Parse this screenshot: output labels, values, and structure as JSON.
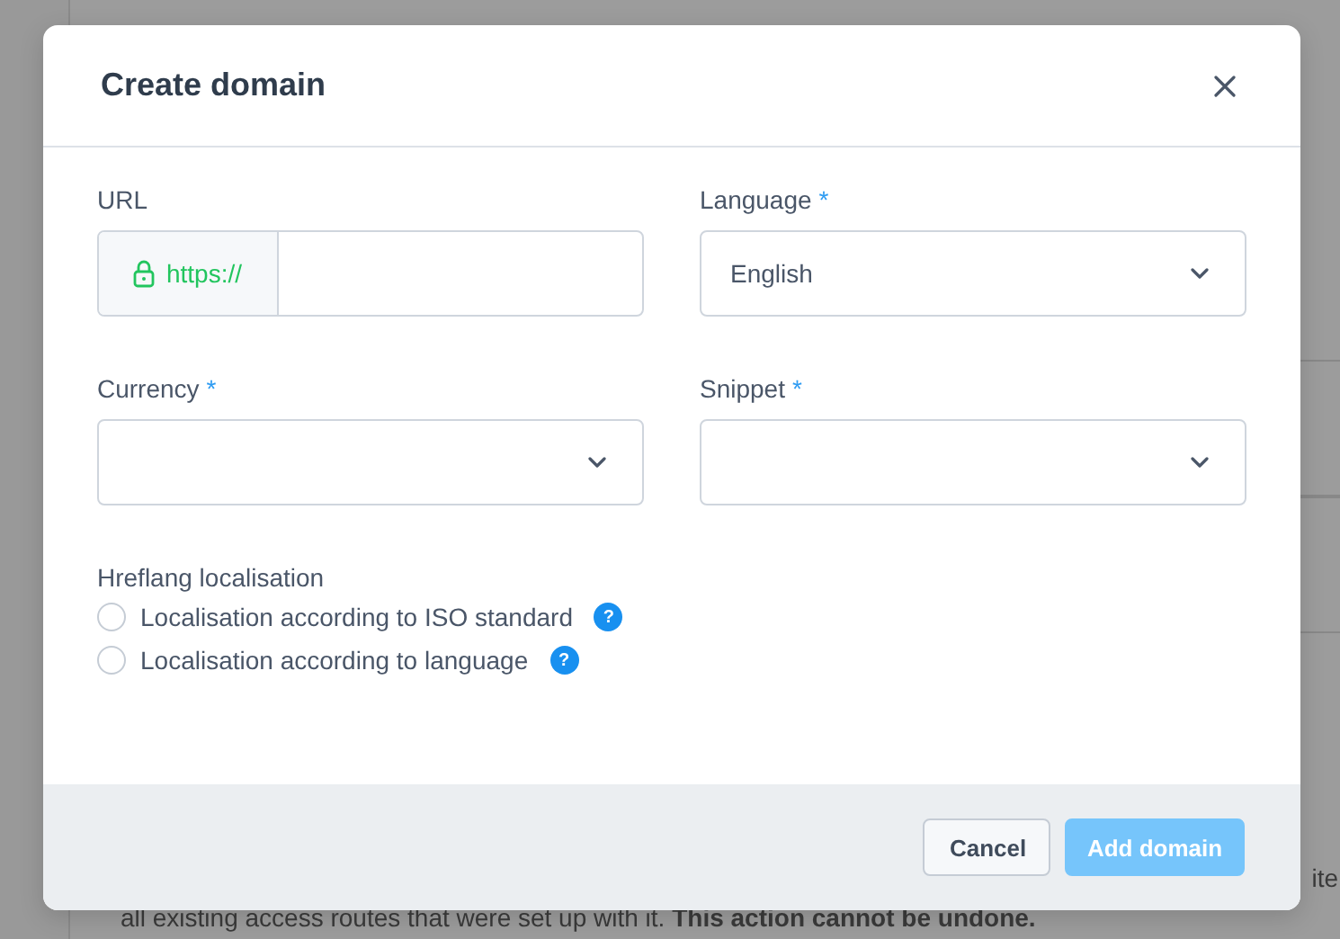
{
  "background": {
    "fragment": "ite",
    "notice": "all existing access routes that were set up with it. **This action cannot be undone.**"
  },
  "dialog": {
    "title": "Create domain",
    "fields": [
      {
        "kind": "url",
        "label": "URL",
        "prefix": "https://"
      },
      {
        "kind": "select",
        "label": "Language",
        "required_mark": "*",
        "value": "English"
      },
      {
        "kind": "select",
        "label": "Currency",
        "required_mark": "*"
      },
      {
        "kind": "select",
        "label": "Snippet",
        "required_mark": "*"
      }
    ],
    "hreflang": {
      "label": "Hreflang localisation",
      "options": [
        {
          "label": "Localisation according to ISO standard",
          "selected": false,
          "help": "?"
        },
        {
          "label": "Localisation according to language",
          "selected": false,
          "help": "?"
        }
      ]
    },
    "buttons": [
      {
        "label": "Cancel",
        "kind": "secondary",
        "disabled": false
      },
      {
        "label": "Add domain",
        "kind": "primary",
        "disabled": true
      }
    ]
  }
}
